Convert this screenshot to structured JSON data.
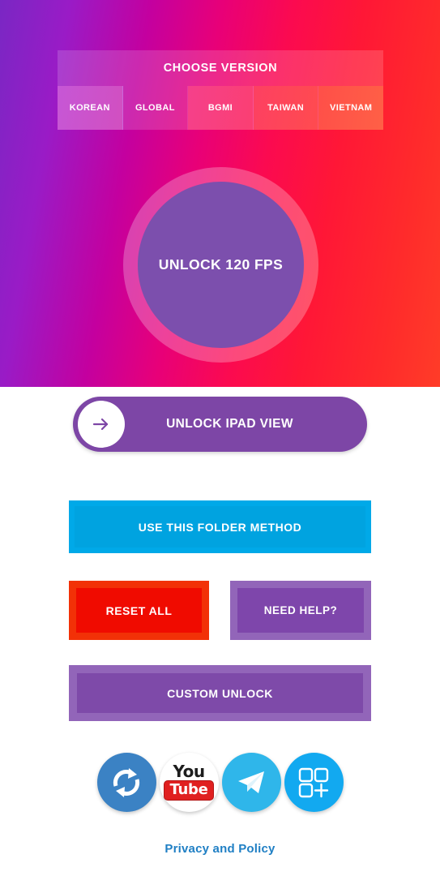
{
  "hero": {
    "gradient_from": "#7a27c4",
    "gradient_mid": "#e80078",
    "gradient_to": "#ff3c28",
    "version_panel": {
      "title": "CHOOSE VERSION",
      "tabs": [
        {
          "label": "KOREAN",
          "color": "#c657d6",
          "selected": false
        },
        {
          "label": "GLOBAL",
          "color": "transparent",
          "selected": true
        },
        {
          "label": "BGMI",
          "color": "#f5408b",
          "selected": false
        },
        {
          "label": "TAIWAN",
          "color": "#fd4062",
          "selected": false
        },
        {
          "label": "VIETNAM",
          "color": "#ff4f49",
          "selected": false
        }
      ]
    },
    "fps_button": {
      "label": "UNLOCK 120 FPS",
      "ring_color": "#bfa0d4",
      "core_color": "#7c4fad"
    }
  },
  "actions": {
    "ipad": {
      "label": "UNLOCK IPAD VIEW",
      "color": "#7d46a6",
      "icon": "arrow-right-icon"
    },
    "folder": {
      "label": "USE THIS FOLDER METHOD",
      "color": "#00a3e0"
    },
    "reset": {
      "label": "RESET ALL",
      "color": "#f00b00"
    },
    "help": {
      "label": "NEED HELP?",
      "color": "#7e46ab"
    },
    "custom": {
      "label": "CUSTOM UNLOCK",
      "color": "#7e4aa9"
    }
  },
  "social": {
    "items": [
      {
        "name": "sync-icon",
        "label": "Update",
        "color": "#3b82c4"
      },
      {
        "name": "youtube-icon",
        "label": "YouTube",
        "color": "#e02020",
        "text_top": "You",
        "text_bottom": "Tube"
      },
      {
        "name": "telegram-icon",
        "label": "Telegram",
        "color": "#2fb6ea"
      },
      {
        "name": "more-apps-icon",
        "label": "More Apps",
        "color": "#12a9f0"
      }
    ]
  },
  "footer": {
    "privacy_label": "Privacy and Policy",
    "privacy_color": "#1f7fc4"
  }
}
